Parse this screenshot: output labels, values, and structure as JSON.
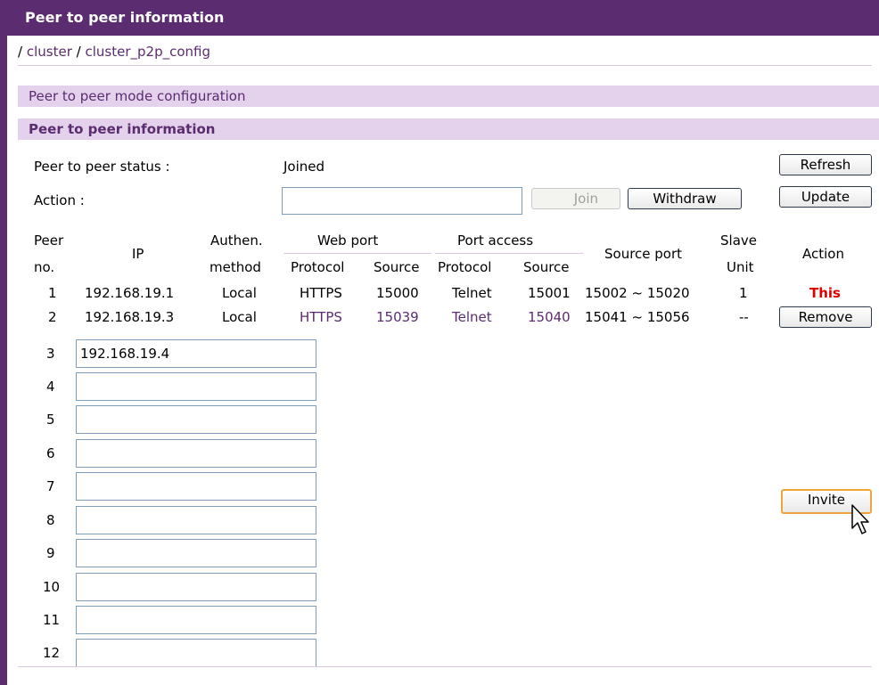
{
  "title": "Peer to peer information",
  "breadcrumb": {
    "sep": "/",
    "item1": "cluster",
    "item2": "cluster_p2p_config"
  },
  "mode_bar": "Peer to peer mode configuration",
  "info_bar": "Peer to peer information",
  "status": {
    "label": "Peer to peer status :",
    "value": "Joined"
  },
  "action": {
    "label": "Action :",
    "value": ""
  },
  "buttons": {
    "refresh": "Refresh",
    "update": "Update",
    "join": "Join",
    "withdraw": "Withdraw",
    "remove": "Remove",
    "invite": "Invite"
  },
  "headers": {
    "peer_no_1": "Peer",
    "peer_no_2": "no.",
    "ip": "IP",
    "auth_1": "Authen.",
    "auth_2": "method",
    "web_port": "Web port",
    "web_protocol": "Protocol",
    "web_source": "Source",
    "port_access": "Port access",
    "pa_protocol": "Protocol",
    "pa_source": "Source",
    "source_port": "Source port",
    "slave_1": "Slave",
    "slave_2": "Unit",
    "action": "Action"
  },
  "rows": [
    {
      "no": "1",
      "ip": "192.168.19.1",
      "auth": "Local",
      "web_protocol": "HTTPS",
      "web_source": "15000",
      "pa_protocol": "Telnet",
      "pa_source": "15001",
      "source_port": "15002 ~ 15020",
      "slave": "1",
      "action": "This"
    },
    {
      "no": "2",
      "ip": "192.168.19.3",
      "auth": "Local",
      "web_protocol": "HTTPS",
      "web_source": "15039",
      "pa_protocol": "Telnet",
      "pa_source": "15040",
      "source_port": "15041 ~ 15056",
      "slave": "--"
    }
  ],
  "invite_rows": [
    {
      "no": "3",
      "value": "192.168.19.4"
    },
    {
      "no": "4",
      "value": ""
    },
    {
      "no": "5",
      "value": ""
    },
    {
      "no": "6",
      "value": ""
    },
    {
      "no": "7",
      "value": ""
    },
    {
      "no": "8",
      "value": ""
    },
    {
      "no": "9",
      "value": ""
    },
    {
      "no": "10",
      "value": ""
    },
    {
      "no": "11",
      "value": ""
    },
    {
      "no": "12",
      "value": ""
    }
  ],
  "icons": {
    "cursor": "mouse-pointer-icon"
  },
  "colors": {
    "brand": "#5b2c6f",
    "bar": "#e4d1ec",
    "this_label": "#e00000"
  }
}
